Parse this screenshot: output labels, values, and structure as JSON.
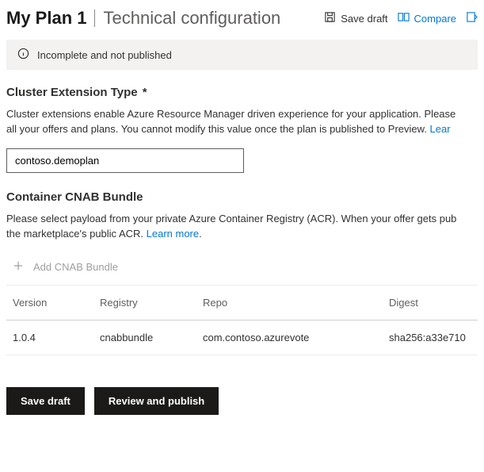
{
  "header": {
    "plan_name": "My Plan 1",
    "subtitle": "Technical configuration",
    "save_draft_label": "Save draft",
    "compare_label": "Compare"
  },
  "status": {
    "text": "Incomplete and not published"
  },
  "cluster_ext": {
    "title": "Cluster Extension Type",
    "required_marker": "*",
    "desc_a": "Cluster extensions enable Azure Resource Manager driven experience for your application. Please ",
    "desc_b": "all your offers and plans. You cannot modify this value once the plan is published to Preview. ",
    "learn_more": "Lear",
    "value": "contoso.demoplan"
  },
  "cnab": {
    "title": "Container CNAB Bundle",
    "desc_a": "Please select payload from your private Azure Container Registry (ACR). When your offer gets pub",
    "desc_b": "the marketplace's public ACR. ",
    "learn_more": "Learn more",
    "learn_more_suffix": ".",
    "add_label": "Add CNAB Bundle",
    "columns": {
      "version": "Version",
      "registry": "Registry",
      "repo": "Repo",
      "digest": "Digest"
    },
    "rows": [
      {
        "version": "1.0.4",
        "registry": "cnabbundle",
        "repo": "com.contoso.azurevote",
        "digest": "sha256:a33e710"
      }
    ]
  },
  "footer": {
    "save_draft": "Save draft",
    "review_publish": "Review and publish"
  }
}
